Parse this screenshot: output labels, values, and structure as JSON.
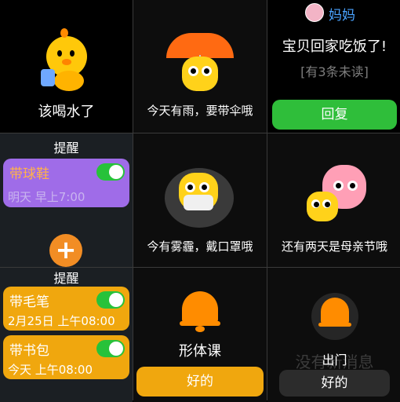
{
  "cells": {
    "water": {
      "text": "该喝水了"
    },
    "rain": {
      "text": "今天有雨，要带伞哦"
    },
    "message": {
      "sender": "妈妈",
      "text": "宝贝回家吃饭了!",
      "unread": "[有3条未读]",
      "reply": "回复"
    },
    "reminder1": {
      "header": "提醒",
      "items": [
        {
          "title": "带球鞋",
          "sub": "明天 早上7:00"
        }
      ],
      "add": "+"
    },
    "smog": {
      "text": "今有雾霾，戴口罩哦"
    },
    "mothersday": {
      "text": "还有两天是母亲节哦"
    },
    "reminder2": {
      "header": "提醒",
      "items": [
        {
          "title": "带毛笔",
          "sub": "2月25日 上午08:00"
        },
        {
          "title": "带书包",
          "sub": "今天 上午08:00"
        }
      ]
    },
    "alarm1": {
      "label": "形体课",
      "ok": "好的"
    },
    "alarm2": {
      "label": "出门",
      "faded": "没有新消息",
      "ok": "好的"
    }
  },
  "colors": {
    "green": "#2fbe3a",
    "orange": "#f0a70e",
    "purple": "#9f6ce8",
    "bell": "#ff8c00"
  }
}
